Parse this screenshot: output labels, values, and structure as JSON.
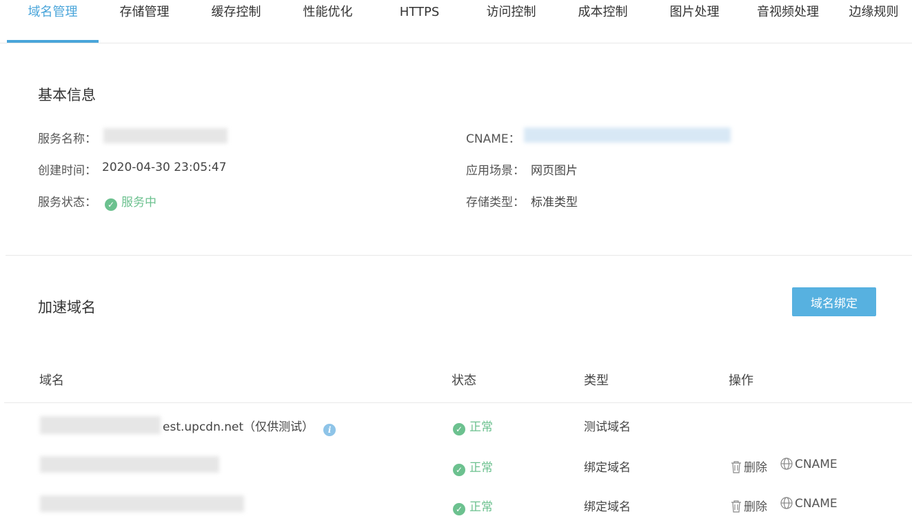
{
  "tabs": [
    {
      "label": "域名管理",
      "active": true
    },
    {
      "label": "存储管理"
    },
    {
      "label": "缓存控制"
    },
    {
      "label": "性能优化"
    },
    {
      "label": "HTTPS"
    },
    {
      "label": "访问控制"
    },
    {
      "label": "成本控制"
    },
    {
      "label": "图片处理"
    },
    {
      "label": "音视频处理"
    },
    {
      "label": "边缘规则"
    }
  ],
  "basic_info": {
    "title": "基本信息",
    "service_name_label": "服务名称：",
    "created_label": "创建时间：",
    "created_value": "2020-04-30 23:05:47",
    "status_label": "服务状态：",
    "status_value": "服务中",
    "cname_label": "CNAME：",
    "scene_label": "应用场景：",
    "scene_value": "网页图片",
    "storage_label": "存储类型：",
    "storage_value": "标准类型"
  },
  "domains": {
    "title": "加速域名",
    "bind_button": "域名绑定",
    "headers": {
      "domain": "域名",
      "status": "状态",
      "type": "类型",
      "ops": "操作"
    },
    "rows": [
      {
        "domain_suffix": "est.upcdn.net（仅供测试）",
        "status": "正常",
        "type": "测试域名"
      },
      {
        "status": "正常",
        "type": "绑定域名",
        "delete": "删除",
        "cname": "CNAME"
      },
      {
        "status": "正常",
        "type": "绑定域名",
        "delete": "删除",
        "cname": "CNAME"
      }
    ]
  },
  "colors": {
    "accent": "#4aa5da",
    "success": "#6cc18f",
    "button": "#57b1e0"
  }
}
